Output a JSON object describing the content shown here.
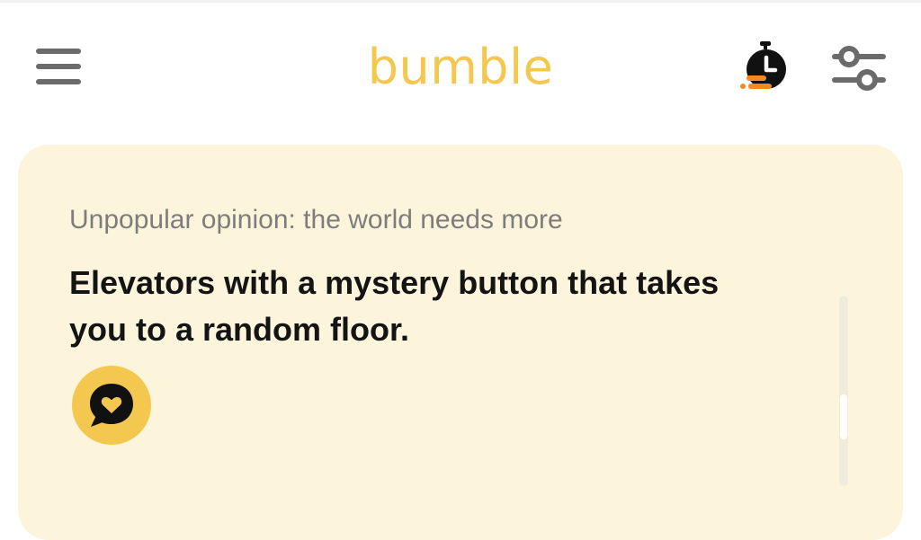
{
  "header": {
    "logo_text": "bumble",
    "menu_icon": "hamburger-menu-icon",
    "boost_icon": "stopwatch-boost-icon",
    "filter_icon": "filter-sliders-icon"
  },
  "profile_card": {
    "prompt_label": "Unpopular opinion: the world needs more",
    "prompt_answer": "Elevators with a mystery button that takes you to a random floor.",
    "comment_icon": "heart-chat-bubble-icon"
  },
  "colors": {
    "brand_yellow": "#f4c84e",
    "card_background": "#fcf5dc",
    "icon_gray": "#6b6b6b",
    "boost_orange": "#f28a1f",
    "text_dark": "#141414",
    "text_muted": "#7d7d7d"
  }
}
